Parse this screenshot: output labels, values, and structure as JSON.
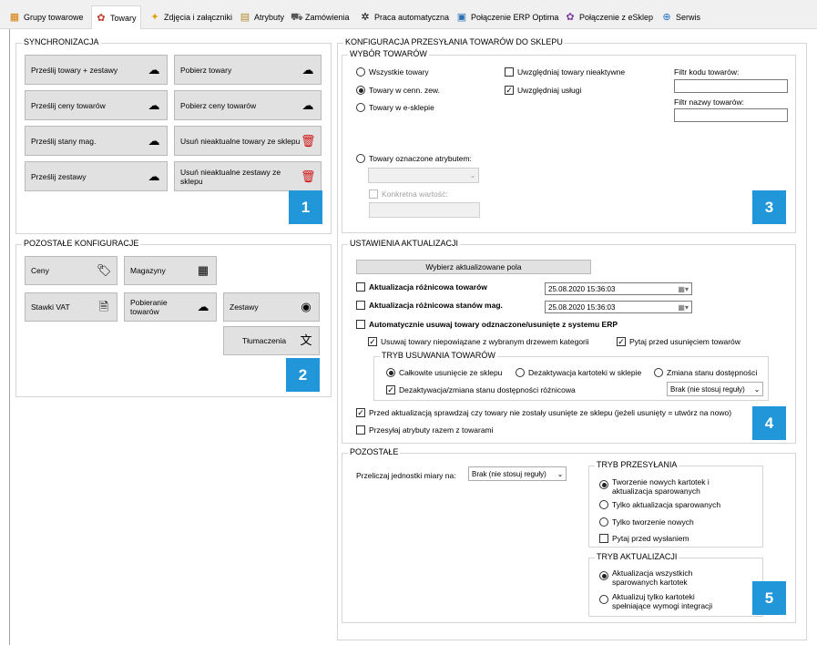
{
  "tabs": [
    {
      "label": "Grupy towarowe",
      "icon": "groups-icon",
      "glyph": "▦",
      "color": "#d47a00"
    },
    {
      "label": "Towary",
      "icon": "products-icon",
      "glyph": "✿",
      "color": "#c0392b"
    },
    {
      "label": "Zdjęcia i załączniki",
      "icon": "pictures-icon",
      "glyph": "✦",
      "color": "#e0a000"
    },
    {
      "label": "Atrybuty",
      "icon": "attributes-icon",
      "glyph": "▤",
      "color": "#b08a2a"
    },
    {
      "label": "Zamówienia",
      "icon": "cart-icon",
      "glyph": "⛟",
      "color": "#555"
    },
    {
      "label": "Praca automatyczna",
      "icon": "automation-icon",
      "glyph": "✲",
      "color": "#333"
    },
    {
      "label": "Połączenie ERP Optima",
      "icon": "erp-icon",
      "glyph": "▣",
      "color": "#2a6fb0"
    },
    {
      "label": "Połączenie z eSklep",
      "icon": "eshop-icon",
      "glyph": "✿",
      "color": "#7a3fa0"
    },
    {
      "label": "Serwis",
      "icon": "service-icon",
      "glyph": "⊕",
      "color": "#1f6fbf"
    }
  ],
  "sync": {
    "title": "SYNCHRONIZACJA",
    "buttons": [
      {
        "label": "Prześlij towary + zestawy",
        "icon": "cloud-upload-icon"
      },
      {
        "label": "Pobierz towary",
        "icon": "cloud-download-icon"
      },
      {
        "label": "Prześlij ceny towarów",
        "icon": "cloud-upload-icon"
      },
      {
        "label": "Pobierz ceny towarów",
        "icon": "cloud-download-icon"
      },
      {
        "label": "Prześlij stany mag.",
        "icon": "cloud-upload-icon"
      },
      {
        "label": "Usuń nieaktualne towary ze sklepu",
        "icon": "trash-icon"
      },
      {
        "label": "Prześlij zestawy",
        "icon": "cloud-upload-icon"
      },
      {
        "label": "Usuń nieaktualne zestawy ze sklepu",
        "icon": "trash-icon"
      }
    ],
    "badge": "1"
  },
  "other": {
    "title": "POZOSTAŁE KONFIGURACJE",
    "buttons": [
      {
        "label": "Ceny",
        "icon": "price-tag-icon"
      },
      {
        "label": "Magazyny",
        "icon": "warehouse-icon"
      },
      {
        "label": "Stawki VAT",
        "icon": "document-icon"
      },
      {
        "label": "Pobieranie towarów",
        "icon": "cloud-download-icon"
      },
      {
        "label": "Zestawy",
        "icon": "bundle-icon"
      },
      {
        "label": "Tłumaczenia",
        "icon": "translate-icon"
      }
    ],
    "badge": "2"
  },
  "config": {
    "title": "KONFIGURACJA PRZESYŁANIA TOWARÓW DO SKLEPU",
    "selection": {
      "title": "WYBÓR TOWARÓW",
      "radios": [
        "Wszystkie towary",
        "Towary w cenn. zew.",
        "Towary w e-sklepie",
        "Towary oznaczone atrybutem:"
      ],
      "selected_radio": 1,
      "include_inactive": "Uwzględniaj towary nieaktywne",
      "include_services": "Uwzględniaj usługi",
      "code_filter_label": "Filtr kodu towarów:",
      "name_filter_label": "Filtr nazwy towarów:",
      "specific_value": "Konkretna wartość:",
      "badge": "3"
    },
    "update": {
      "title": "USTAWIENIA AKTUALIZACJI",
      "choose_fields": "Wybierz aktualizowane pola",
      "diff_products": "Aktualizacja różnicowa towarów",
      "diff_products_date": "25.08.2020 15:36:03",
      "diff_stock": "Aktualizacja różnicowa stanów mag.",
      "diff_stock_date": "25.08.2020 15:36:03",
      "auto_remove": "Automatycznie usuwaj towary odznaczone/usunięte z systemu ERP",
      "remove_unlinked": "Usuwaj towary niepowiązane z wybranym drzewem kategorii",
      "ask_before": "Pytaj przed usunięciem towarów",
      "removal_mode": {
        "title": "TRYB USUWANIA TOWARÓW",
        "options": [
          "Całkowite usunięcie ze sklepu",
          "Dezaktywacja kartoteki w sklepie",
          "Zmiana stanu dostępności"
        ],
        "selected": 0,
        "diff_deactivation": "Dezaktywacja/zmiana stanu dostępności różnicowa",
        "rule_select": "Brak (nie stosuj reguły)"
      },
      "check_deleted": "Przed aktualizacją sprawdzaj czy towary nie zostały usunięte ze sklepu (jeżeli usunięty = utwórz na nowo)",
      "send_attributes": "Przesyłaj atrybuty razem z towarami",
      "badge": "4"
    },
    "other": {
      "title": "POZOSTAŁE",
      "units_label": "Przeliczaj jednostki miary na:",
      "units_select": "Brak (nie stosuj reguły)",
      "send_mode": {
        "title": "TRYB PRZESYŁANIA",
        "options": [
          "Tworzenie nowych kartotek i aktualizacja sparowanych",
          "Tylko aktualizacja sparowanych",
          "Tylko tworzenie nowych"
        ],
        "selected": 0,
        "ask_before_send": "Pytaj przed wysłaniem"
      },
      "update_mode": {
        "title": "TRYB AKTUALIZACJI",
        "options": [
          "Aktualizacja wszystkich sparowanych kartotek",
          "Aktualizuj tylko kartoteki spełniające wymogi integracji"
        ],
        "selected": 0
      },
      "badge": "5"
    }
  }
}
